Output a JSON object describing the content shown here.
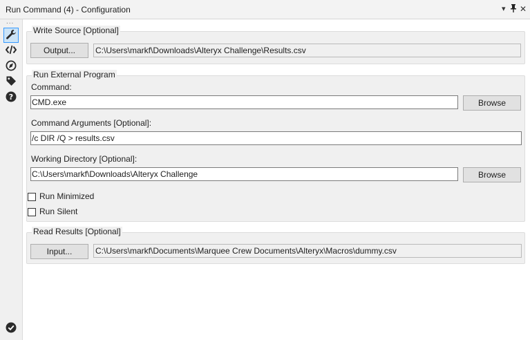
{
  "window": {
    "title": "Run Command (4) - Configuration",
    "controls": {
      "menu": "▾",
      "pin": "📌",
      "close": "✕"
    }
  },
  "sidebar": {
    "more": "...",
    "items": [
      {
        "icon": "wrench-icon",
        "active": true
      },
      {
        "icon": "code-icon",
        "active": false
      },
      {
        "icon": "compass-icon",
        "active": false
      },
      {
        "icon": "tag-icon",
        "active": false
      },
      {
        "icon": "help-icon",
        "active": false
      }
    ],
    "status_icon": "check-circle-icon"
  },
  "write_source": {
    "legend": "Write Source [Optional]",
    "button_label": "Output...",
    "path": "C:\\Users\\markf\\Downloads\\Alteryx Challenge\\Results.csv"
  },
  "run_external": {
    "legend": "Run External Program",
    "command_label": "Command:",
    "command_value": "CMD.exe",
    "command_browse": "Browse",
    "args_label": "Command Arguments [Optional]:",
    "args_value": "/c DIR /Q > results.csv",
    "workdir_label": "Working Directory [Optional]:",
    "workdir_value": "C:\\Users\\markf\\Downloads\\Alteryx Challenge",
    "workdir_browse": "Browse",
    "run_minimized_label": "Run Minimized",
    "run_minimized_checked": false,
    "run_silent_label": "Run Silent",
    "run_silent_checked": false
  },
  "read_results": {
    "legend": "Read Results [Optional]",
    "button_label": "Input...",
    "path": "C:\\Users\\markf\\Documents\\Marquee Crew Documents\\Alteryx\\Macros\\dummy.csv"
  }
}
